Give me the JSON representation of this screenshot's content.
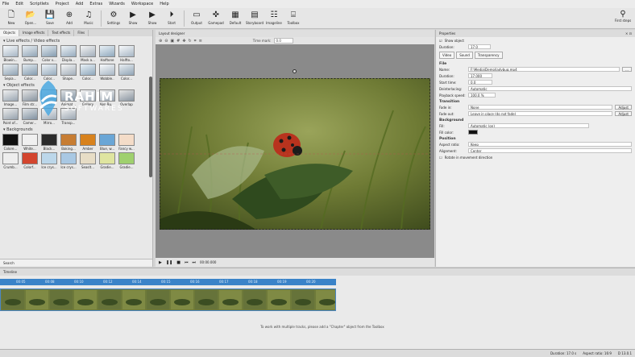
{
  "menu": [
    "File",
    "Edit",
    "Scriptlets",
    "Project",
    "Add",
    "Extras",
    "Wizards",
    "Workspace",
    "Help"
  ],
  "toolbar": {
    "items": [
      {
        "label": "New",
        "icon": "new-file-icon"
      },
      {
        "label": "Open...",
        "icon": "open-folder-icon"
      },
      {
        "label": "Save",
        "icon": "save-icon"
      },
      {
        "label": "Add",
        "icon": "add-icon"
      },
      {
        "label": "Music",
        "icon": "music-icon"
      },
      {
        "label": "Settings",
        "icon": "gear-icon"
      },
      {
        "label": "Show",
        "icon": "play-icon"
      },
      {
        "label": "Show",
        "icon": "play-icon"
      },
      {
        "label": "Start",
        "icon": "start-icon"
      },
      {
        "label": "Output",
        "icon": "monitor-icon"
      },
      {
        "label": "Gamepad",
        "icon": "gamepad-icon"
      },
      {
        "label": "Default",
        "icon": "layout-icon"
      },
      {
        "label": "Storyboard",
        "icon": "storyboard-icon"
      },
      {
        "label": "Imageline",
        "icon": "imageline-icon"
      },
      {
        "label": "Toolbox",
        "icon": "toolbox-icon"
      }
    ],
    "first_steps": "First steps"
  },
  "left": {
    "tabs": [
      "Objects",
      "Image effects",
      "Text effects",
      "Files"
    ],
    "live_effects_title": "Live effects / Video effects",
    "live_effects": [
      "Blowin...",
      "Bump...",
      "Color v...",
      "Displa...",
      "Mask a...",
      "Halftone",
      "Halfto...",
      "Sepia...",
      "Color...",
      "Color...",
      "Shape..",
      "Color...",
      "Wobble..",
      "Color..."
    ],
    "object_effects_title": "Object effects",
    "object_effects": [
      "Image...",
      "Film str...",
      "Photo...",
      "Animat...",
      "Gallery",
      "Ken Bu...",
      "Overlap",
      "Point of...",
      "Camer...",
      "Mirro...",
      "Transp..."
    ],
    "backgrounds_title": "Backgrounds",
    "backgrounds": [
      "Colore...",
      "White...",
      "Black...",
      "Baking...",
      "Amber",
      "Blue, w...",
      "Fancy w...",
      "Crumb...",
      "Colorf...",
      "Ice crys...",
      "Ice crys...",
      "Seaslt...",
      "Gradie...",
      "Gradie..."
    ],
    "search": "Search"
  },
  "center": {
    "title": "Layout designer",
    "time_mark_label": "Time mark:",
    "time_mark_value": "0.0",
    "timecode": "00:00.000"
  },
  "props": {
    "title": "Properties",
    "show_object": "Show object",
    "duration_label": "Duration:",
    "duration_value": "17.0",
    "tabs": [
      "Video",
      "Sound",
      "Transparency"
    ],
    "section_file": "File",
    "name_label": "Name:",
    "name_value": "F:\\Media\\Demo\\ladybug.mp4",
    "duration2_label": "Duration:",
    "duration2_value": "17.000",
    "start_label": "Start time:",
    "start_value": "0.0",
    "interlacing_label": "Deinterlacing:",
    "interlacing_value": "Automatic",
    "speed_label": "Playback speed:",
    "speed_value": "100.0 %",
    "section_transition": "Transition",
    "fadein_label": "Fade in:",
    "fadein_value": "None",
    "fadeout_label": "Fade out:",
    "fadeout_value": "Leave in place (do not fade)",
    "adjust": "Adjust",
    "section_background": "Background",
    "fill_label": "Fill:",
    "fill_value": "Automatic (on)",
    "fillcolor_label": "Fill color:",
    "section_position": "Position",
    "aspect_label": "Aspect ratio:",
    "aspect_value": "Keep",
    "alignment_label": "Alignment:",
    "alignment_value": "Center",
    "rotate_label": "Rotate in movement direction"
  },
  "timeline": {
    "title": "Timeline",
    "message": "To work with multiple tracks, please add a \"Chapter\" object from the Toolbox",
    "ruler": [
      "00:05",
      "00:08",
      "00:10",
      "00:12",
      "00:14",
      "00:15",
      "00:16",
      "00:17",
      "00:18",
      "00:19",
      "00:20"
    ]
  },
  "status": {
    "duration": "Duration: 17.0 s",
    "aspect": "Aspect ratio: 16:9",
    "version": "D 13.0.1"
  },
  "watermark": {
    "line1": "RAHIM",
    "line2": "SOFTWARES"
  }
}
